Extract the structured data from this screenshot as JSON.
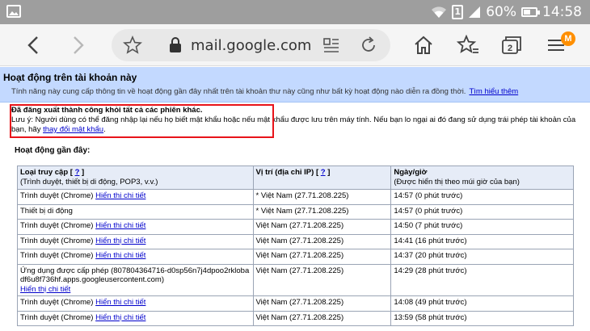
{
  "status_bar": {
    "battery": "60%",
    "battery_level": 0.6,
    "time": "14:58",
    "sim": "1"
  },
  "browser": {
    "url": "mail.google.com",
    "tabs_count": "2",
    "profile_initial": "M",
    "accent": "#ff8f00"
  },
  "page": {
    "title": "Hoạt động trên tài khoản này",
    "description": "Tính năng này cung cấp thông tin về hoạt động gần đây nhất trên tài khoản thư này cũng như bất kỳ hoạt động nào diễn ra đồng thời.",
    "learn_more": "Tìm hiểu thêm",
    "notice_title": "Đã đăng xuất thành công khỏi tất cả các phiên khác.",
    "notice_text": "Lưu ý: Người dùng có thể đăng nhập lại nếu họ biết mật khẩu hoặc nếu mật khẩu được lưu trên máy tính. Nếu bạn lo ngại ai đó đang sử dụng trái phép tài khoản của bạn, hãy",
    "change_password": "thay đổi mật khẩu",
    "notice_end": ".",
    "recent_title": "Hoạt động gần đây:",
    "highlight_color": "#e8141a"
  },
  "table": {
    "headers": {
      "access_type": "Loại truy cập",
      "access_help": "?",
      "access_sub": "(Trình duyệt, thiết bị di động, POP3, v.v.)",
      "location": "Vị trí (địa chỉ IP)",
      "location_help": "?",
      "datetime": "Ngày/giờ",
      "datetime_sub": "(Được hiển thị theo múi giờ của bạn)"
    },
    "rows": [
      {
        "access": "Trình duyệt (Chrome)",
        "link": "Hiển thị chi tiết",
        "location": "* Việt Nam (27.71.208.225)",
        "time": "14:57 (0 phút trước)"
      },
      {
        "access": "Thiết bị di động",
        "link": "",
        "location": "* Việt Nam (27.71.208.225)",
        "time": "14:57 (0 phút trước)"
      },
      {
        "access": "Trình duyệt (Chrome)",
        "link": "Hiển thị chi tiết",
        "location": "Việt Nam (27.71.208.225)",
        "time": "14:50 (7 phút trước)"
      },
      {
        "access": "Trình duyệt (Chrome)",
        "link": "Hiển thị chi tiết",
        "location": "Việt Nam (27.71.208.225)",
        "time": "14:41 (16 phút trước)"
      },
      {
        "access": "Trình duyệt (Chrome)",
        "link": "Hiển thị chi tiết",
        "location": "Việt Nam (27.71.208.225)",
        "time": "14:37 (20 phút trước)"
      },
      {
        "access": "Ứng dụng được cấp phép (807804364716-d0sp56n7j4dpoo2rklobadf6u8f736hf.apps.googleusercontent.com)",
        "link": "Hiển thị chi tiết",
        "location": "Việt Nam (27.71.208.225)",
        "time": "14:29 (28 phút trước)"
      },
      {
        "access": "Trình duyệt (Chrome)",
        "link": "Hiển thị chi tiết",
        "location": "Việt Nam (27.71.208.225)",
        "time": "14:08 (49 phút trước)"
      },
      {
        "access": "Trình duyệt (Chrome)",
        "link": "Hiển thị chi tiết",
        "location": "Việt Nam (27.71.208.225)",
        "time": "13:59 (58 phút trước)"
      }
    ]
  }
}
